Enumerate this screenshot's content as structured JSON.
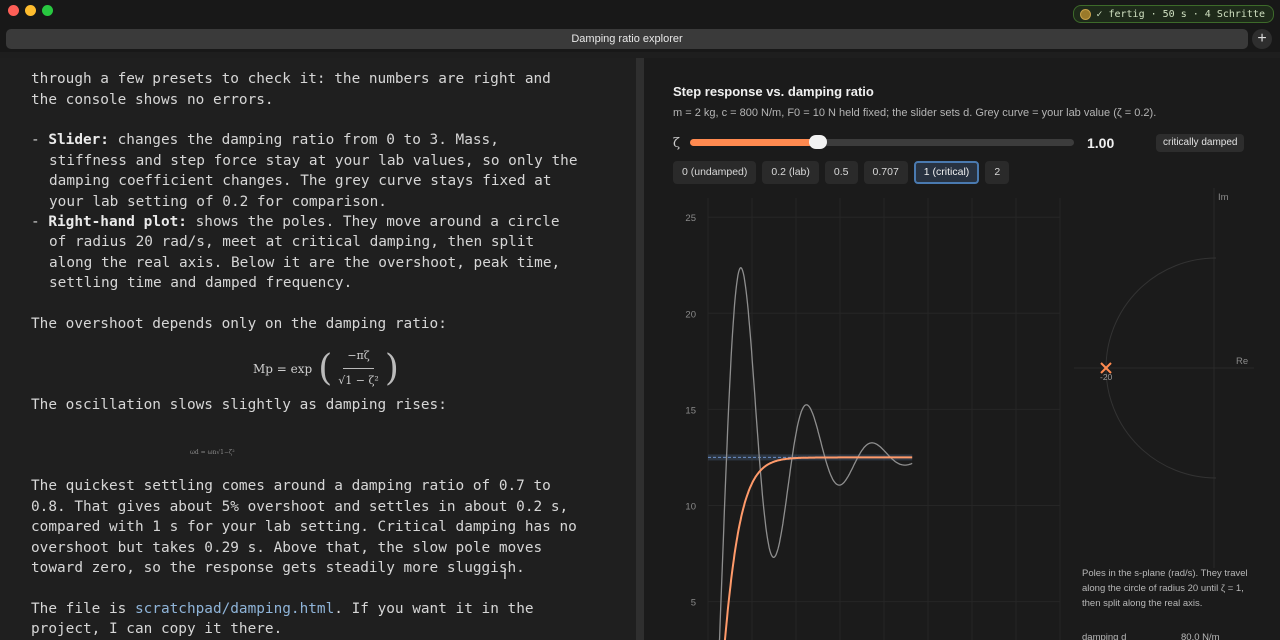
{
  "status": {
    "text": "✓ fertig · 50 s · 4 Schritte"
  },
  "tab": {
    "title": "Damping ratio explorer",
    "new_tab": "+"
  },
  "terminal": {
    "lines": [
      "through a few presets to check it: the numbers are right and",
      "the console shows no errors.",
      "Slider:",
      " changes the damping ratio from 0 to 3. Mass,",
      "stiffness and step force stay at your lab values, so only the",
      "damping coefficient changes. The grey curve stays fixed at",
      "your lab setting of 0.2 for comparison.",
      "Right-hand plot:",
      " shows the poles. They move around a circle",
      "of radius 20 rad/s, meet at critical damping, then split",
      "along the real axis. Below it are the overshoot, peak time,",
      "settling time and damped frequency.",
      "The overshoot depends only on the damping ratio:",
      "The oscillation slows slightly as damping rises:",
      "The quickest settling comes around a damping ratio of 0.7 to",
      "0.8. That gives about 5% overshoot and settles in about 0.2 s,",
      "compared with 1 s for your lab setting. Critical damping has no",
      "overshoot but takes 0.29 s. Above that, the slow pole moves",
      "toward zero, so the response gets steadily more sluggish.",
      "The file is ",
      "scratchpad/damping.html",
      ". If you want it in the",
      "project, I can copy it there."
    ],
    "bullet": "- ",
    "formula": {
      "lhs": "Mp = exp",
      "num": "−πζ",
      "den": "√1 − ζ²"
    },
    "formula_small": "ωd = ωn√1−ζ²"
  },
  "panel": {
    "title": "Step response vs. damping ratio",
    "subtitle": "m = 2 kg, c = 800 N/m, F0 = 10 N held fixed; the slider sets d. Grey curve = your lab value (ζ = 0.2).",
    "slider_symbol": "ζ",
    "zeta_value": 1.0,
    "zeta_min": 0,
    "zeta_max": 3,
    "zeta_display": "1.00",
    "regime": "critically damped",
    "presets": [
      {
        "label": "0 (undamped)"
      },
      {
        "label": "0.2 (lab)"
      },
      {
        "label": "0.5"
      },
      {
        "label": "0.707"
      },
      {
        "label": "1 (critical)",
        "active": true
      },
      {
        "label": "2"
      }
    ],
    "pole_caption": "Poles in the s-plane (rad/s). They travel along the circle of radius 20 until ζ = 1, then split along the real axis.",
    "pole_readout_label": "damping d",
    "pole_readout_value": "80.0 N/m"
  },
  "chart_data": [
    {
      "type": "line",
      "yticks": [
        5,
        10,
        15,
        20,
        25
      ],
      "ylim": [
        3,
        26
      ],
      "xlim": [
        0,
        1
      ],
      "reference_y": 12.5,
      "series": [
        {
          "kind": "lab",
          "zeta": 0.2,
          "color": "#8e8e8e"
        },
        {
          "kind": "current",
          "zeta": 1.0,
          "color": "#ff9a6a"
        }
      ],
      "reference_band": {
        "y": 12.5,
        "color": "#6a90c8"
      }
    },
    {
      "type": "scatter",
      "axis_labels": {
        "x": "Re",
        "y": "Im"
      },
      "points": [
        {
          "re": -20,
          "im": 0,
          "label": "-20",
          "color": "#ff8a50"
        }
      ],
      "circle_radius": 20
    }
  ],
  "colors": {
    "accent": "#ff8a50",
    "lab": "#8e8e8e",
    "active_border": "#4a7ab0"
  }
}
